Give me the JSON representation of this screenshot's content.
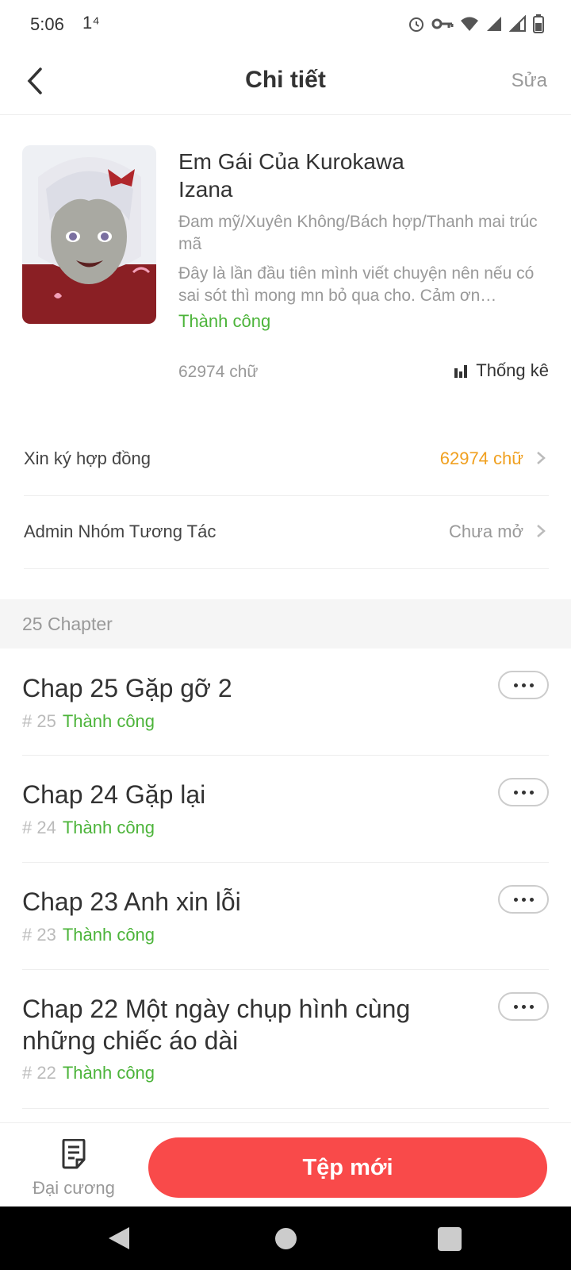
{
  "status_bar": {
    "time": "5:06",
    "extra": "1⁴"
  },
  "header": {
    "title": "Chi tiết",
    "edit_label": "Sửa"
  },
  "book": {
    "title": "Em Gái Của Kurokawa Izana",
    "genres": "Đam mỹ/Xuyên Không/Bách hợp/Thanh mai trúc mã",
    "description": "Đây là lần đầu tiên mình viết chuyện nên nếu có sai sót thì mong mn bỏ qua cho. Cảm ơn…",
    "status": "Thành công",
    "word_count": "62974 chữ",
    "stats_label": "Thống kê"
  },
  "menu": [
    {
      "label": "Xin ký hợp đồng",
      "value": "62974 chữ",
      "color": "#f0a020"
    },
    {
      "label": "Admin Nhóm Tương Tác",
      "value": "Chưa mở",
      "color": "#999999"
    }
  ],
  "chapters_header": "25 Chapter",
  "chapters": [
    {
      "title": "Chap 25 Gặp gỡ 2",
      "num": "# 25",
      "status": "Thành công"
    },
    {
      "title": "Chap 24 Gặp lại",
      "num": "# 24",
      "status": "Thành công"
    },
    {
      "title": "Chap 23 Anh xin lỗi",
      "num": "# 23",
      "status": "Thành công"
    },
    {
      "title": "Chap 22 Một ngày chụp hình cùng những chiếc áo dài",
      "num": "# 22",
      "status": "Thành công"
    }
  ],
  "bottom": {
    "outline_label": "Đại cương",
    "new_file_label": "Tệp mới"
  },
  "colors": {
    "accent": "#f94a4a",
    "success": "#4cb43a"
  }
}
